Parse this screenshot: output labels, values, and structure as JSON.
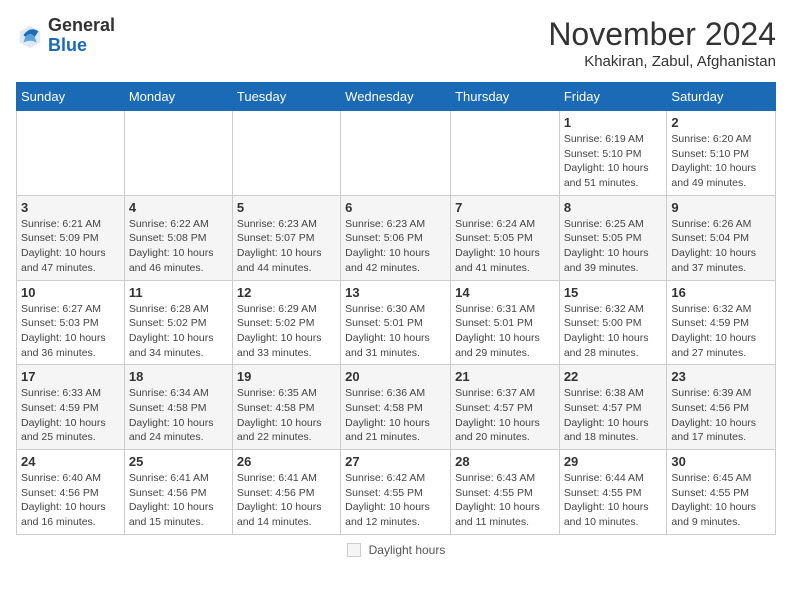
{
  "logo": {
    "general": "General",
    "blue": "Blue"
  },
  "title": "November 2024",
  "location": "Khakiran, Zabul, Afghanistan",
  "headers": [
    "Sunday",
    "Monday",
    "Tuesday",
    "Wednesday",
    "Thursday",
    "Friday",
    "Saturday"
  ],
  "footer": {
    "daylight_label": "Daylight hours"
  },
  "weeks": [
    [
      {
        "day": "",
        "info": ""
      },
      {
        "day": "",
        "info": ""
      },
      {
        "day": "",
        "info": ""
      },
      {
        "day": "",
        "info": ""
      },
      {
        "day": "",
        "info": ""
      },
      {
        "day": "1",
        "info": "Sunrise: 6:19 AM\nSunset: 5:10 PM\nDaylight: 10 hours and 51 minutes."
      },
      {
        "day": "2",
        "info": "Sunrise: 6:20 AM\nSunset: 5:10 PM\nDaylight: 10 hours and 49 minutes."
      }
    ],
    [
      {
        "day": "3",
        "info": "Sunrise: 6:21 AM\nSunset: 5:09 PM\nDaylight: 10 hours and 47 minutes."
      },
      {
        "day": "4",
        "info": "Sunrise: 6:22 AM\nSunset: 5:08 PM\nDaylight: 10 hours and 46 minutes."
      },
      {
        "day": "5",
        "info": "Sunrise: 6:23 AM\nSunset: 5:07 PM\nDaylight: 10 hours and 44 minutes."
      },
      {
        "day": "6",
        "info": "Sunrise: 6:23 AM\nSunset: 5:06 PM\nDaylight: 10 hours and 42 minutes."
      },
      {
        "day": "7",
        "info": "Sunrise: 6:24 AM\nSunset: 5:05 PM\nDaylight: 10 hours and 41 minutes."
      },
      {
        "day": "8",
        "info": "Sunrise: 6:25 AM\nSunset: 5:05 PM\nDaylight: 10 hours and 39 minutes."
      },
      {
        "day": "9",
        "info": "Sunrise: 6:26 AM\nSunset: 5:04 PM\nDaylight: 10 hours and 37 minutes."
      }
    ],
    [
      {
        "day": "10",
        "info": "Sunrise: 6:27 AM\nSunset: 5:03 PM\nDaylight: 10 hours and 36 minutes."
      },
      {
        "day": "11",
        "info": "Sunrise: 6:28 AM\nSunset: 5:02 PM\nDaylight: 10 hours and 34 minutes."
      },
      {
        "day": "12",
        "info": "Sunrise: 6:29 AM\nSunset: 5:02 PM\nDaylight: 10 hours and 33 minutes."
      },
      {
        "day": "13",
        "info": "Sunrise: 6:30 AM\nSunset: 5:01 PM\nDaylight: 10 hours and 31 minutes."
      },
      {
        "day": "14",
        "info": "Sunrise: 6:31 AM\nSunset: 5:01 PM\nDaylight: 10 hours and 29 minutes."
      },
      {
        "day": "15",
        "info": "Sunrise: 6:32 AM\nSunset: 5:00 PM\nDaylight: 10 hours and 28 minutes."
      },
      {
        "day": "16",
        "info": "Sunrise: 6:32 AM\nSunset: 4:59 PM\nDaylight: 10 hours and 27 minutes."
      }
    ],
    [
      {
        "day": "17",
        "info": "Sunrise: 6:33 AM\nSunset: 4:59 PM\nDaylight: 10 hours and 25 minutes."
      },
      {
        "day": "18",
        "info": "Sunrise: 6:34 AM\nSunset: 4:58 PM\nDaylight: 10 hours and 24 minutes."
      },
      {
        "day": "19",
        "info": "Sunrise: 6:35 AM\nSunset: 4:58 PM\nDaylight: 10 hours and 22 minutes."
      },
      {
        "day": "20",
        "info": "Sunrise: 6:36 AM\nSunset: 4:58 PM\nDaylight: 10 hours and 21 minutes."
      },
      {
        "day": "21",
        "info": "Sunrise: 6:37 AM\nSunset: 4:57 PM\nDaylight: 10 hours and 20 minutes."
      },
      {
        "day": "22",
        "info": "Sunrise: 6:38 AM\nSunset: 4:57 PM\nDaylight: 10 hours and 18 minutes."
      },
      {
        "day": "23",
        "info": "Sunrise: 6:39 AM\nSunset: 4:56 PM\nDaylight: 10 hours and 17 minutes."
      }
    ],
    [
      {
        "day": "24",
        "info": "Sunrise: 6:40 AM\nSunset: 4:56 PM\nDaylight: 10 hours and 16 minutes."
      },
      {
        "day": "25",
        "info": "Sunrise: 6:41 AM\nSunset: 4:56 PM\nDaylight: 10 hours and 15 minutes."
      },
      {
        "day": "26",
        "info": "Sunrise: 6:41 AM\nSunset: 4:56 PM\nDaylight: 10 hours and 14 minutes."
      },
      {
        "day": "27",
        "info": "Sunrise: 6:42 AM\nSunset: 4:55 PM\nDaylight: 10 hours and 12 minutes."
      },
      {
        "day": "28",
        "info": "Sunrise: 6:43 AM\nSunset: 4:55 PM\nDaylight: 10 hours and 11 minutes."
      },
      {
        "day": "29",
        "info": "Sunrise: 6:44 AM\nSunset: 4:55 PM\nDaylight: 10 hours and 10 minutes."
      },
      {
        "day": "30",
        "info": "Sunrise: 6:45 AM\nSunset: 4:55 PM\nDaylight: 10 hours and 9 minutes."
      }
    ]
  ]
}
